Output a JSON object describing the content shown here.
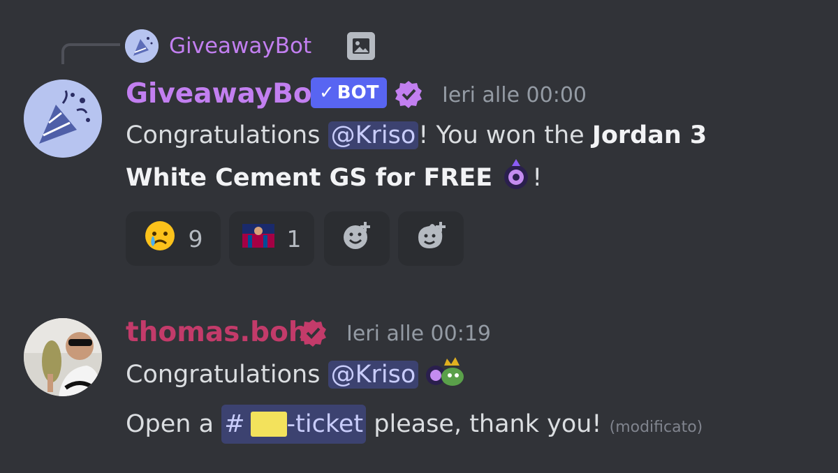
{
  "reply": {
    "username": "GiveawayBot"
  },
  "message1": {
    "username": "GiveawayBot",
    "bot_tag": "BOT",
    "timestamp": "Ieri alle 00:00",
    "text_before": "Congratulations ",
    "mention": "@Kriso",
    "text_middle": "! You won the ",
    "bold_line1": "Jordan 3",
    "bold_line2": "White Cement GS for FREE",
    "text_after": "!"
  },
  "reactions": [
    {
      "emoji": "crying-face",
      "count": "9"
    },
    {
      "emoji": "messi-image",
      "count": "1"
    }
  ],
  "message2": {
    "username": "thomas.boh",
    "timestamp": "Ieri alle 00:19",
    "line1_text": "Congratulations ",
    "mention": "@Kriso",
    "line2_before": "Open a ",
    "channel_hash": "#",
    "channel_name": "-ticket",
    "line2_after": " please, thank you!",
    "edited": "(modificato)"
  },
  "colors": {
    "background": "#313338",
    "bot_name": "#c27ff0",
    "user2_name": "#c33b6a",
    "bot_tag": "#5865f2",
    "mention_bg": "#3c4270"
  }
}
